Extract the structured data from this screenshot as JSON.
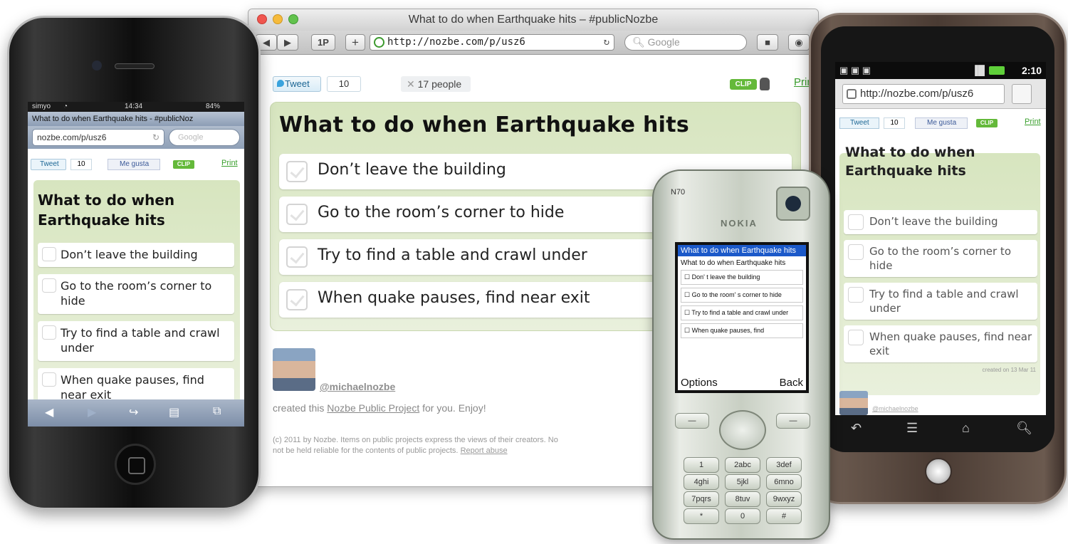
{
  "browser": {
    "window_title": "What to do when Earthquake hits – #publicNozbe",
    "nav_buttons": [
      "◀",
      "▶",
      "1P",
      "+"
    ],
    "url": "http://nozbe.com/p/usz6",
    "search_placeholder": "Google",
    "share": {
      "tweet_label": "Tweet",
      "tweet_count": "10",
      "people_label": "17 people"
    },
    "clip_label": "CLIP",
    "print_label": "Print",
    "project_title": "What to do when Earthquake hits",
    "tasks": [
      "Don’t leave the building",
      "Go to the room’s corner to hide",
      "Try to find a table and crawl under",
      "When quake pauses, find near exit"
    ],
    "author": "@michaelnozbe",
    "created_prefix": "created this",
    "created_link": "Nozbe Public Project",
    "created_suffix": "for you. Enjoy!",
    "footer_text": "(c) 2011 by Nozbe. Items on public projects express the views of their creators. No",
    "footer_text2": "not be held reliable for the contents of public projects.",
    "report_link": "Report abuse"
  },
  "iphone": {
    "carrier": "simyo",
    "time": "14:34",
    "battery": "84%",
    "page_title": "What to do when Earthquake hits - #publicNoz",
    "url": "nozbe.com/p/usz6",
    "search_placeholder": "Google",
    "tweet_label": "Tweet",
    "tweet_count": "10",
    "like_label": "Me gusta",
    "clip_label": "CLIP",
    "print_label": "Print",
    "project_title": "What to do when Earthquake hits",
    "tasks": [
      "Don’t leave the building",
      "Go to the room’s corner to hide",
      "Try to find a table and crawl under",
      "When quake pauses, find near exit"
    ]
  },
  "android": {
    "time": "2:10",
    "url": "http://nozbe.com/p/usz6",
    "tweet_label": "Tweet",
    "tweet_count": "10",
    "like_label": "Me gusta",
    "clip_label": "CLIP",
    "print_label": "Print",
    "project_title": "What to do when Earthquake hits",
    "tasks": [
      "Don’t leave the building",
      "Go to the room’s corner to hide",
      "Try to find a table and crawl under",
      "When quake pauses, find near exit"
    ],
    "created_note": "created on 13 Mar 11",
    "author": "@michaelnozbe"
  },
  "nokia": {
    "model": "N70",
    "brand": "NOKIA",
    "page_title": "What to do when Earthquake hits",
    "heading": "What to do when Earthquake hits",
    "tasks": [
      "Don' t leave the building",
      "Go to the room' s corner to hide",
      "Try to find a table and crawl under",
      "When quake pauses, find"
    ],
    "softkey_left": "Options",
    "softkey_right": "Back",
    "keys": [
      "1",
      "2abc",
      "3def",
      "4ghi",
      "5jkl",
      "6mno",
      "7pqrs",
      "8tuv",
      "9wxyz",
      "*",
      "0",
      "#"
    ]
  }
}
